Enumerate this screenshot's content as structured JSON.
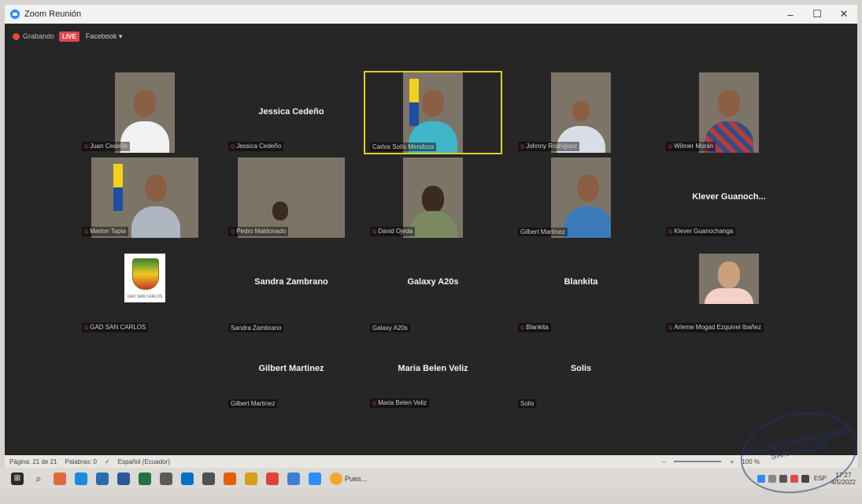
{
  "window": {
    "title": "Zoom Reunión",
    "minimize": "–",
    "maximize": "☐",
    "close": "✕"
  },
  "topbar": {
    "recording_label": "Grabando",
    "live_label": "LIVE",
    "platform_label": "Facebook ▾"
  },
  "tiles": [
    {
      "display_name": "",
      "label": "Juan Cedeño"
    },
    {
      "display_name": "Jessica Cedeño",
      "label": "Jessica Cedeño"
    },
    {
      "display_name": "",
      "label": "Carlos Solís Mendoza"
    },
    {
      "display_name": "",
      "label": "Johnny Rodríguez"
    },
    {
      "display_name": "",
      "label": "Wilmer Morán"
    },
    {
      "display_name": "",
      "label": "Marlon Tapia"
    },
    {
      "display_name": "",
      "label": "Pedro Maldonado"
    },
    {
      "display_name": "",
      "label": "David Ojeda"
    },
    {
      "display_name": "",
      "label": "Gilbert Martínez"
    },
    {
      "display_name": "Klever  Guanoch...",
      "label": "Klever Guanochanga"
    },
    {
      "display_name": "",
      "label": "GAD SAN CARLOS"
    },
    {
      "display_name": "Sandra Zambrano",
      "label": "Sandra Zambrano"
    },
    {
      "display_name": "Galaxy A20s",
      "label": "Galaxy A20s"
    },
    {
      "display_name": "Blankita",
      "label": "Blankita"
    },
    {
      "display_name": "",
      "label": "Arleme Mogad Ezquivel Ibañez"
    },
    {
      "display_name": "Gilbert Martinez",
      "label": "Gilbert Martinez"
    },
    {
      "display_name": "Maria Belen Veliz",
      "label": "Maria Belen Veliz"
    },
    {
      "display_name": "Solis",
      "label": "Solis"
    }
  ],
  "emblem_caption": "GAD SAN CARLOS",
  "statusbar": {
    "page": "Página: 21 de 21",
    "words": "Palabras: 0",
    "language": "Español (Ecuador)",
    "zoom": "100 %"
  },
  "taskbar": {
    "app_text": "Pues...",
    "lang": "ESP",
    "time": "17:27",
    "date": "4/5/2022"
  },
  "stamp": {
    "text": "GAD DESCENTRALIZADO SAN CARLOS"
  },
  "colors": {
    "meeting_bg": "#262626",
    "active_speaker": "#d9d122",
    "mic_off": "#e04a4a"
  }
}
